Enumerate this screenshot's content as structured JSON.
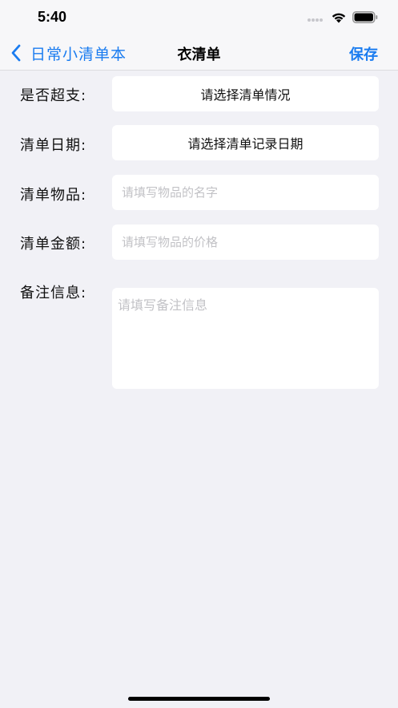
{
  "status_bar": {
    "time": "5:40",
    "signal_icon": "signal-dots-icon",
    "wifi_icon": "wifi-icon",
    "battery_icon": "battery-icon"
  },
  "nav": {
    "back_label": "日常小清单本",
    "title": "衣清单",
    "save_label": "保存",
    "back_icon": "chevron-left-icon",
    "accent_color": "#1a7cf0"
  },
  "form": {
    "overspend": {
      "label": "是否超支:",
      "value": "请选择清单情况"
    },
    "date": {
      "label": "清单日期:",
      "value": "请选择清单记录日期"
    },
    "item": {
      "label": "清单物品:",
      "placeholder": "请填写物品的名字"
    },
    "amount": {
      "label": "清单金额:",
      "placeholder": "请填写物品的价格"
    },
    "note": {
      "label": "备注信息:",
      "placeholder": "请填写备注信息"
    }
  }
}
